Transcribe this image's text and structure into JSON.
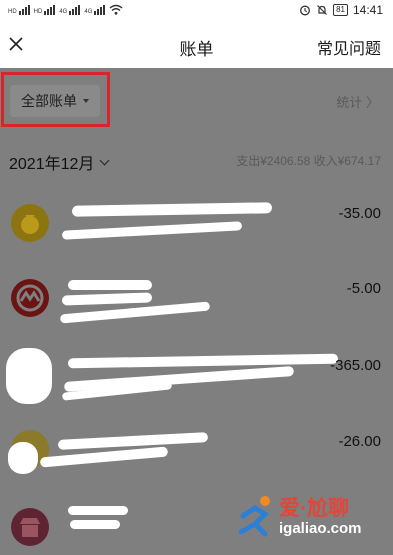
{
  "status_bar": {
    "time": "14:41",
    "battery": "81"
  },
  "header": {
    "title": "账单",
    "faq_label": "常见问题"
  },
  "filter": {
    "label": "全部账单",
    "stats_label": "统计 〉"
  },
  "month": {
    "label": "2021年12月",
    "summary": "支出¥2406.58  收入¥674.17"
  },
  "transactions": [
    {
      "amount": "-35.00"
    },
    {
      "amount": "-5.00"
    },
    {
      "amount": "-365.00"
    },
    {
      "amount": "-26.00"
    },
    {
      "amount": ""
    }
  ],
  "watermark": {
    "main": "爱·尬聊",
    "url": "igaliao.com"
  },
  "colors": {
    "highlight": "#d7252b",
    "overlay": "#7f7f7f"
  }
}
